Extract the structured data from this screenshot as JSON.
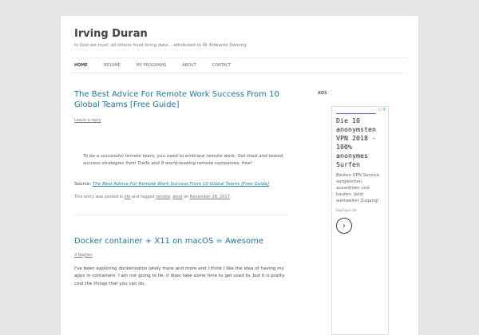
{
  "site": {
    "title": "Irving Duran",
    "description": "In God we trust; all others must bring data... attributed to W. Edwards Deming"
  },
  "nav": [
    "Home",
    "Resume",
    "My Programs",
    "About",
    "Contact"
  ],
  "posts": [
    {
      "title": "The Best Advice For Remote Work Success From 10 Global Teams [Free Guide]",
      "comments": "Leave a reply",
      "quote": "To be a successful remote team, you need to embrace remote work. Get tried and tested success strategies from Trello and 9 world-leading remote companies, free!",
      "source_label": "Source:",
      "source_link": "The Best Advice For Remote Work Success From 10 Global Teams [Free Guide]",
      "footer": {
        "a": "This entry was posted in",
        "cat": "life",
        "b": "and tagged",
        "tag1": "remote",
        "sep": ",",
        "tag2": "work",
        "c": "on",
        "date": "November 28, 2017",
        "end": "."
      }
    },
    {
      "title": "Docker container + X11 on macOS = Awesome",
      "comments": "3 Replies",
      "body": "I've been exploring dockerizaton lately more and more and I think I like the idea of having my apps in containers.  I am not going to lie, it does take some time to get used to, but it is pretty cool the things that you can do."
    }
  ],
  "sidebar": {
    "ads_title": "ADS",
    "ad": {
      "close": "▷✕",
      "headline": "Die 10 anonymsten VPN 2018 - 100% anonymes Surfen",
      "body": "Besten VPN Service vergleichen, auswählen und kaufen. Jetzt weltweiter Zugang!",
      "url": "top5vpn.de",
      "go": "›"
    }
  }
}
